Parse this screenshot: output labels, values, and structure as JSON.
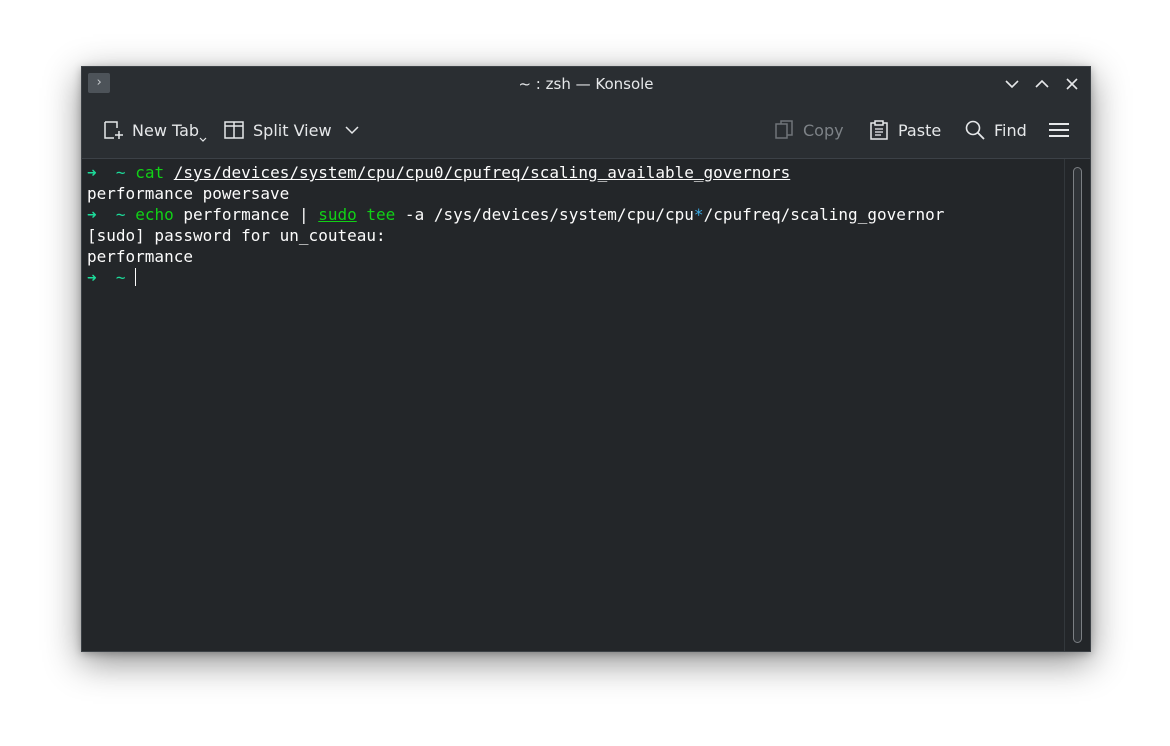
{
  "window": {
    "title": "~ : zsh — Konsole",
    "app_icon_glyph": "›"
  },
  "toolbar": {
    "new_tab_label": "New Tab",
    "split_view_label": "Split View",
    "copy_label": "Copy",
    "paste_label": "Paste",
    "find_label": "Find"
  },
  "terminal": {
    "prompt_arrow": "➜",
    "prompt_dir": "~",
    "line1": {
      "cmd": "cat",
      "arg": "/sys/devices/system/cpu/cpu0/cpufreq/scaling_available_governors"
    },
    "line2": "performance powersave",
    "line3": {
      "cmd": "echo",
      "arg1": " performance | ",
      "sudo": "sudo",
      "tee": "tee",
      "arg2": " -a /sys/devices/system/cpu/cpu",
      "star": "*",
      "arg3": "/cpufreq/scaling_governor"
    },
    "line4": "[sudo] password for un_couteau:",
    "line5": "performance"
  },
  "colors": {
    "prompt_green": "#1cdc9a",
    "command_green": "#11d116",
    "glob_blue": "#3daee9",
    "background": "#232629"
  },
  "icons": {
    "app": "konsole-app-icon",
    "minimize": "chevron-down-icon",
    "maximize": "chevron-up-icon",
    "close": "close-icon",
    "new_tab": "new-tab-icon",
    "split_view": "split-view-icon",
    "copy": "copy-icon",
    "paste": "paste-icon",
    "find": "search-icon",
    "menu": "hamburger-menu-icon"
  }
}
